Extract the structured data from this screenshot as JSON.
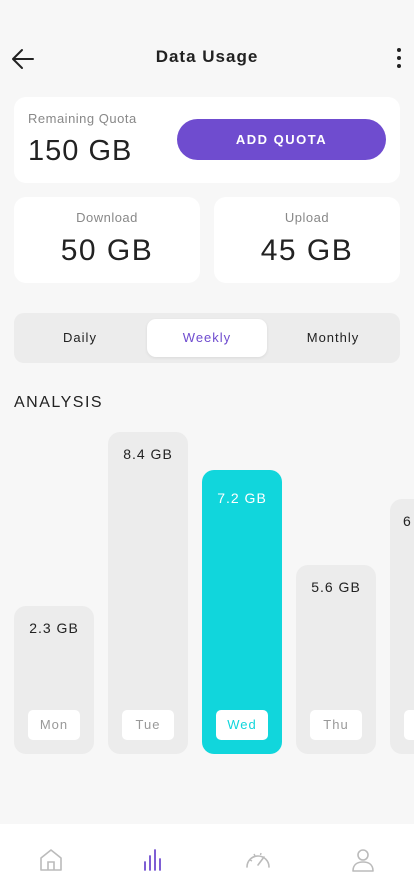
{
  "header": {
    "title": "Data Usage"
  },
  "quota": {
    "label": "Remaining Quota",
    "value": "150 GB",
    "button_label": "ADD QUOTA"
  },
  "download": {
    "label": "Download",
    "value": "50 GB"
  },
  "upload": {
    "label": "Upload",
    "value": "45 GB"
  },
  "tabs": [
    {
      "label": "Daily",
      "active": false
    },
    {
      "label": "Weekly",
      "active": true
    },
    {
      "label": "Monthly",
      "active": false
    }
  ],
  "analysis": {
    "title": "ANALYSIS",
    "bars": [
      {
        "day": "Mon",
        "value_label": "2.3 GB",
        "value": 2.3,
        "active": false
      },
      {
        "day": "Tue",
        "value_label": "8.4 GB",
        "value": 8.4,
        "active": false
      },
      {
        "day": "Wed",
        "value_label": "7.2 GB",
        "value": 7.2,
        "active": true
      },
      {
        "day": "Thu",
        "value_label": "5.6 GB",
        "value": 5.6,
        "active": false
      },
      {
        "day": "",
        "value_label": "6",
        "value": 6.2,
        "active": false
      }
    ]
  },
  "bottom_nav": [
    {
      "icon": "home-icon",
      "active": false
    },
    {
      "icon": "chart-icon",
      "active": true
    },
    {
      "icon": "speedometer-icon",
      "active": false
    },
    {
      "icon": "user-icon",
      "active": false
    }
  ],
  "colors": {
    "accent": "#6f4ccf",
    "highlight": "#11d6dc",
    "background": "#f7f7f7"
  }
}
